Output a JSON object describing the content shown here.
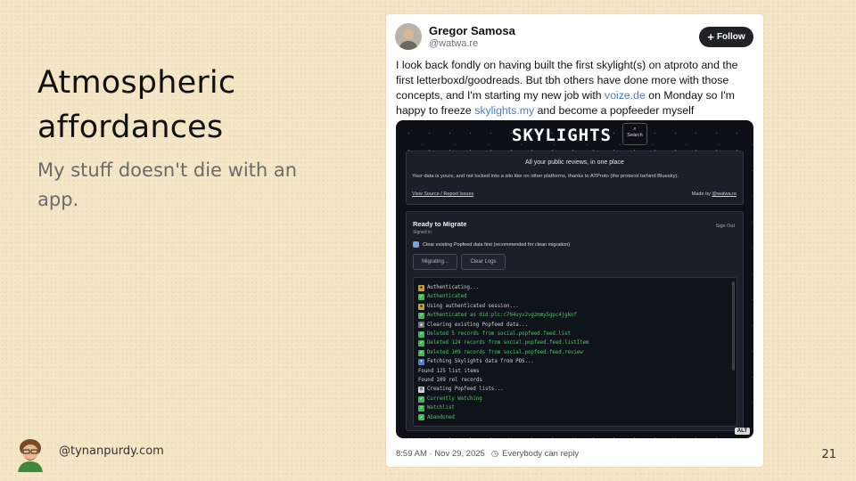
{
  "slide": {
    "title": "Atmospheric affordances",
    "subtitle": "My stuff doesn't die with an app.",
    "footer_handle": "@tynanpurdy.com",
    "page_number": "21"
  },
  "post": {
    "author_name": "Gregor Samosa",
    "author_handle": "@watwa.re",
    "follow_label": "Follow",
    "text_part1": "I look back fondly on having built the first skylight(s) on atproto and the first letterboxd/goodreads. But tbh others have done more with those concepts, and I'm starting my new job with ",
    "link1": "voize.de",
    "text_part2": " on Monday so I'm happy to freeze ",
    "link2": "skylights.my",
    "text_part3": " and become a popfeeder myself",
    "timestamp": "8:59 AM · Nov 29, 2025",
    "reply_setting": "Everybody can reply",
    "alt_label": "ALT"
  },
  "embed": {
    "logo": "SKYLIGHTS",
    "search_label": "Search",
    "intro_heading": "All your public reviews, in one place",
    "intro_body": "Your data is yours, and not locked into a silo like on other platforms, thanks to ATProto (the protocol behind Bluesky).",
    "view_source": "View Source / Report Issues",
    "made_by_prefix": "Made by ",
    "made_by_handle": "@watwa.re",
    "migrate_title": "Ready to Migrate",
    "migrate_sub": "Signed in",
    "sign_out": "Sign Out",
    "checkbox_label": "Clear existing Popfeed data first (recommended for clean migration)",
    "btn_migrating": "Migrating...",
    "btn_clear_logs": "Clear Logs",
    "log": [
      {
        "icon": "lock",
        "tone": "plain",
        "text": "Authenticating..."
      },
      {
        "icon": "check",
        "tone": "green",
        "text": "Authenticated"
      },
      {
        "icon": "lock",
        "tone": "plain",
        "text": "Using authenticated session..."
      },
      {
        "icon": "check",
        "tone": "green",
        "text": "Authenticated as did:plc:c764uyv2vgzmmy5gpc4jgknf"
      },
      {
        "icon": "trash",
        "tone": "plain",
        "text": "Clearing existing Popfeed data..."
      },
      {
        "icon": "check",
        "tone": "green",
        "text": "Deleted 5 records from social.popfeed.feed.list"
      },
      {
        "icon": "check",
        "tone": "green",
        "text": "Deleted 124 records from social.popfeed.feed.listItem"
      },
      {
        "icon": "check",
        "tone": "green",
        "text": "Deleted 109 records from social.popfeed.feed.review"
      },
      {
        "icon": "inbox",
        "tone": "plain",
        "text": "Fetching Skylights data from PDS..."
      },
      {
        "icon": "",
        "tone": "plain",
        "text": "Found 125 list items"
      },
      {
        "icon": "",
        "tone": "plain",
        "text": "Found 109 rel records"
      },
      {
        "icon": "clipboard",
        "tone": "plain",
        "text": "Creating Popfeed lists..."
      },
      {
        "icon": "check",
        "tone": "green",
        "text": "Currently Watching"
      },
      {
        "icon": "check",
        "tone": "green",
        "text": "Watchlist"
      },
      {
        "icon": "check",
        "tone": "green",
        "text": "Abandoned"
      }
    ]
  },
  "colors": {
    "background": "#f4e6c6",
    "link": "#4a7cd6",
    "follow_bg": "#1f2326",
    "log_green": "#52c46a"
  }
}
